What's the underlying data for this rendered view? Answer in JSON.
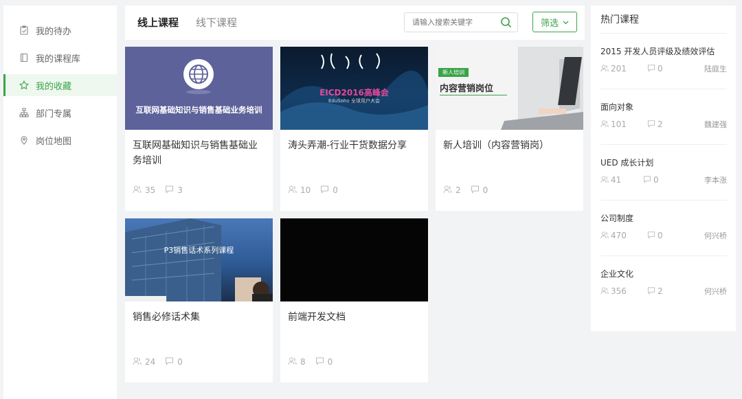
{
  "sidebar": {
    "items": [
      {
        "label": "我的待办",
        "icon": "clipboard-check-icon"
      },
      {
        "label": "我的课程库",
        "icon": "book-icon"
      },
      {
        "label": "我的收藏",
        "icon": "star-icon",
        "active": true
      },
      {
        "label": "部门专属",
        "icon": "org-chart-icon"
      },
      {
        "label": "岗位地图",
        "icon": "map-pin-icon"
      }
    ]
  },
  "header": {
    "tabs": [
      {
        "label": "线上课程",
        "active": true
      },
      {
        "label": "线下课程"
      }
    ],
    "search": {
      "placeholder": "请输入搜索关键字"
    },
    "filter_label": "筛选"
  },
  "courses": [
    {
      "title": "互联网基础知识与销售基础业务培训",
      "users": "35",
      "comments": "3",
      "cover_text": "互联网基础知识与销售基础业务培训"
    },
    {
      "title": "涛头弄潮-行业干货数据分享",
      "users": "10",
      "comments": "0",
      "cover_text": "EICD2016高峰会",
      "cover_sub": "EduSoho 全球用户大会"
    },
    {
      "title": "新人培训（内容营销岗）",
      "users": "2",
      "comments": "0",
      "cover_badge": "新人培训",
      "cover_text": "内容营销岗位"
    },
    {
      "title": "销售必修话术集",
      "users": "24",
      "comments": "0",
      "cover_text": "P3销售话术系列课程"
    },
    {
      "title": "前端开发文档",
      "users": "8",
      "comments": "0"
    }
  ],
  "hot": {
    "title": "热门课程",
    "items": [
      {
        "name": "2015 开发人员评级及绩效评估",
        "users": "201",
        "comments": "0",
        "author": "陆庭生"
      },
      {
        "name": "面向对象",
        "users": "101",
        "comments": "2",
        "author": "魏建强"
      },
      {
        "name": "UED 成长计划",
        "users": "41",
        "comments": "0",
        "author": "李本涨"
      },
      {
        "name": "公司制度",
        "users": "470",
        "comments": "0",
        "author": "何兴桥"
      },
      {
        "name": "企业文化",
        "users": "356",
        "comments": "2",
        "author": "何兴桥"
      }
    ]
  },
  "colors": {
    "accent": "#3aa34a",
    "background": "#f2f3f5"
  }
}
